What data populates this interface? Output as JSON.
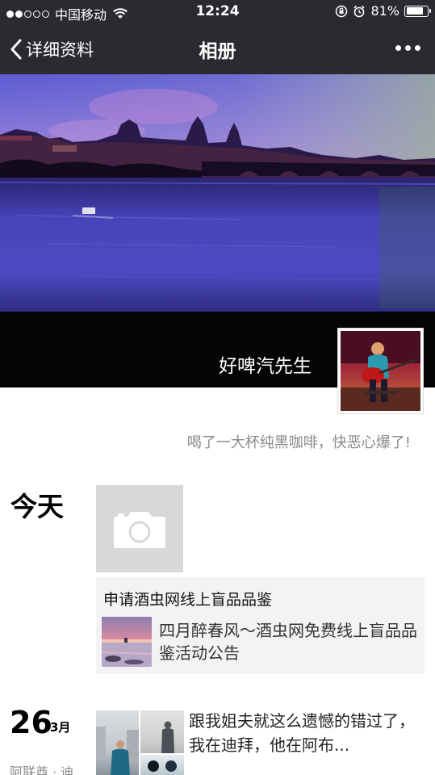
{
  "status_bar": {
    "carrier": "中国移动",
    "time": "12:24",
    "battery_percent": "81%",
    "battery_level": 0.81,
    "signal_bars_filled": 2,
    "signal_bars_total": 5
  },
  "nav": {
    "back_label": "详细资料",
    "title": "相册"
  },
  "profile": {
    "username": "好啤汽先生",
    "signature": "喝了一大杯纯黑咖啡，快恶心爆了!"
  },
  "timeline": {
    "today_label": "今天",
    "shared_post": {
      "text": "申请酒虫网线上盲品品鉴",
      "link_title": "四月醉春风～酒虫网免费线上盲品品鉴活动公告"
    },
    "post2": {
      "day": "26",
      "month": "3月",
      "location": "阿联酋 · 迪",
      "text": "跟我姐夫就这么遗憾的错过了，我在迪拜，他在阿布..."
    }
  },
  "colors": {
    "nav_background": "#2b2a30",
    "card_background": "#f3f3f5",
    "secondary_text": "#8a8a8a"
  }
}
